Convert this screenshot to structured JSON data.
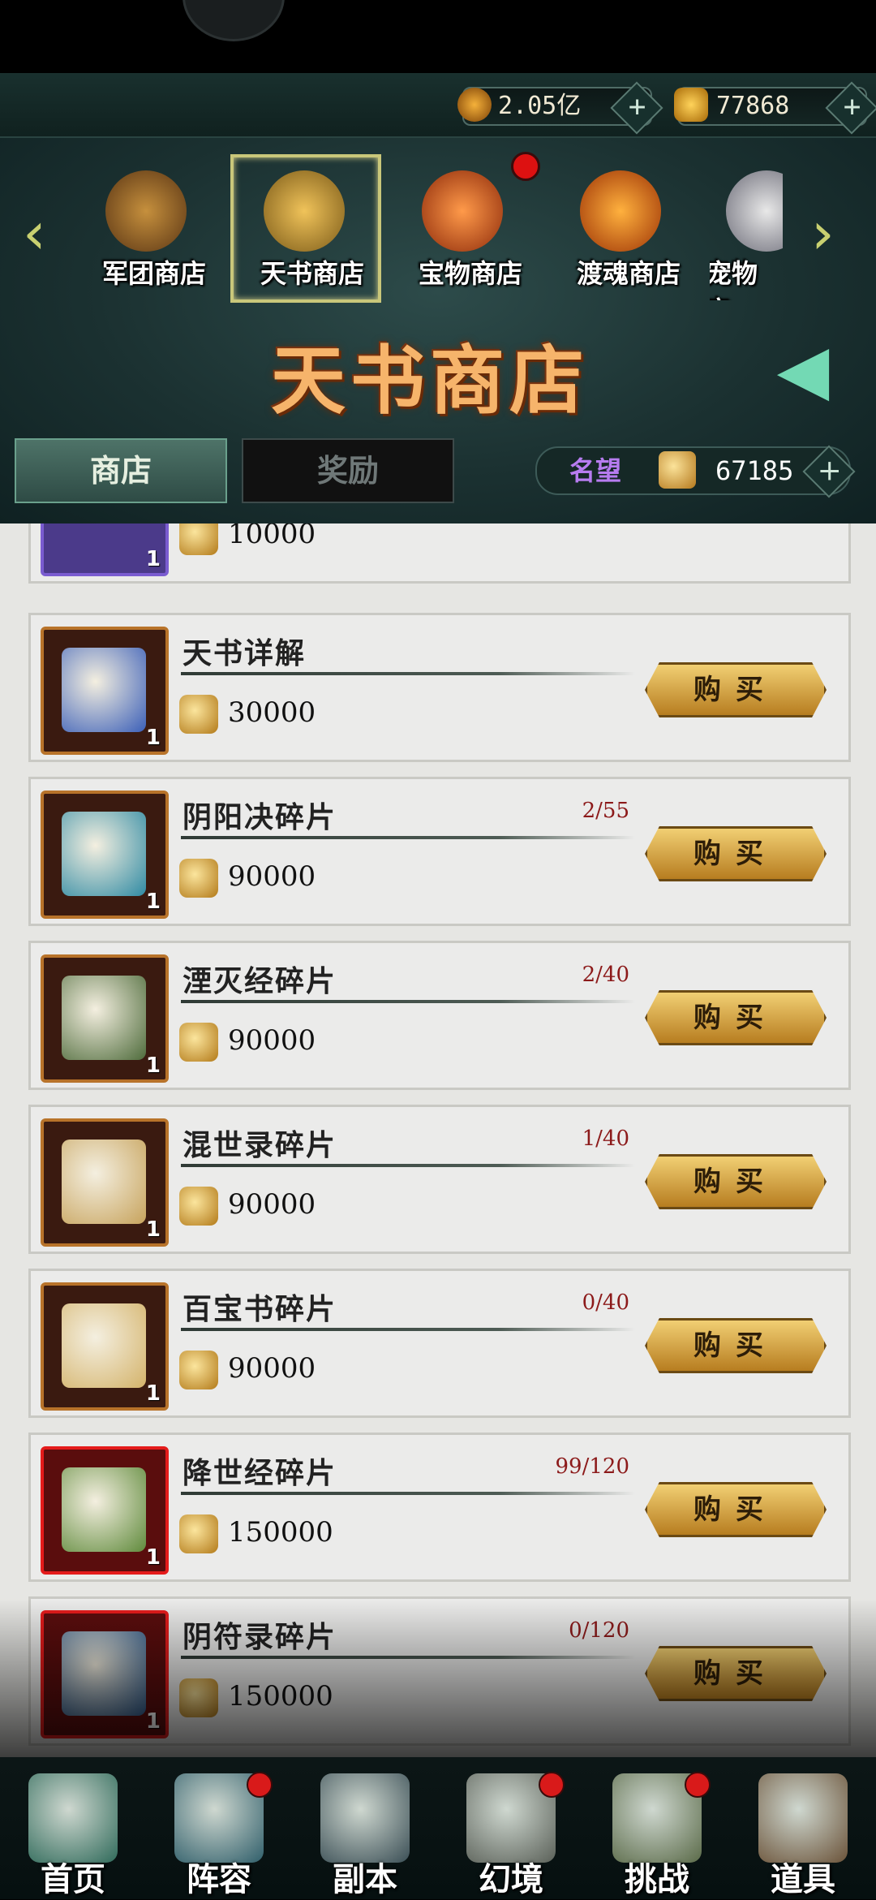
{
  "currency": [
    {
      "icon": "coin-icon",
      "value": "2.05亿"
    },
    {
      "icon": "gold-ingot-icon",
      "value": "77868"
    }
  ],
  "shop_tabs": [
    {
      "label": "军团商店",
      "icon": "legion-shop-icon"
    },
    {
      "label": "天书商店",
      "icon": "tianshu-shop-icon",
      "selected": true
    },
    {
      "label": "宝物商店",
      "icon": "treasure-shop-icon",
      "badge": true
    },
    {
      "label": "渡魂商店",
      "icon": "soul-shop-icon"
    },
    {
      "label": "宠物商",
      "icon": "pet-shop-icon"
    }
  ],
  "shop_title": "天书商店",
  "segments": {
    "shop": "商店",
    "reward": "奖励"
  },
  "reputation": {
    "label": "名望",
    "value": "67185"
  },
  "partial_item": {
    "qty": "1",
    "price": "10000"
  },
  "items": [
    {
      "name": "天书详解",
      "count": "",
      "price": "30000",
      "qty": "1",
      "buy": "购买",
      "rare": false,
      "art": "#3b5fb8"
    },
    {
      "name": "阴阳决碎片",
      "count": "2/55",
      "price": "90000",
      "qty": "1",
      "buy": "购买",
      "rare": false,
      "art": "#2f8aa3"
    },
    {
      "name": "湮灭经碎片",
      "count": "2/40",
      "price": "90000",
      "qty": "1",
      "buy": "购买",
      "rare": false,
      "art": "#4e6b3b"
    },
    {
      "name": "混世录碎片",
      "count": "1/40",
      "price": "90000",
      "qty": "1",
      "buy": "购买",
      "rare": false,
      "art": "#c7a35c"
    },
    {
      "name": "百宝书碎片",
      "count": "0/40",
      "price": "90000",
      "qty": "1",
      "buy": "购买",
      "rare": false,
      "art": "#d4b36a"
    },
    {
      "name": "降世经碎片",
      "count": "99/120",
      "price": "150000",
      "qty": "1",
      "buy": "购买",
      "rare": true,
      "art": "#5f8a3b"
    },
    {
      "name": "阴符录碎片",
      "count": "0/120",
      "price": "150000",
      "qty": "1",
      "buy": "购买",
      "rare": true,
      "art": "#2f5a8a"
    }
  ],
  "bottom_nav": [
    {
      "label": "首页",
      "icon": "home-icon",
      "badge": false
    },
    {
      "label": "阵容",
      "icon": "lineup-icon",
      "badge": true
    },
    {
      "label": "副本",
      "icon": "dungeon-icon",
      "badge": false
    },
    {
      "label": "幻境",
      "icon": "illusion-icon",
      "badge": true
    },
    {
      "label": "挑战",
      "icon": "challenge-icon",
      "badge": true
    },
    {
      "label": "道具",
      "icon": "items-icon",
      "badge": false
    }
  ]
}
